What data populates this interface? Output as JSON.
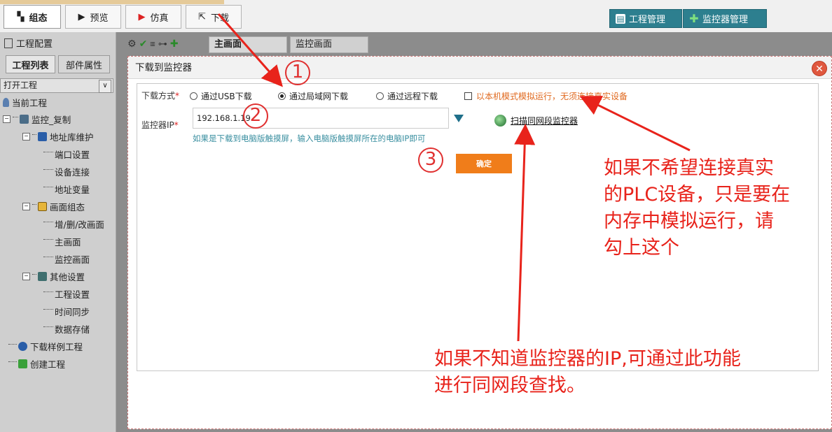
{
  "toolbar": {
    "tabs": [
      {
        "label": "组态",
        "icon": "layout-icon",
        "active": true
      },
      {
        "label": "预览",
        "icon": "play-icon"
      },
      {
        "label": "仿真",
        "icon": "play-red-icon"
      },
      {
        "label": "下载",
        "icon": "share-icon"
      }
    ],
    "project_manager": "工程管理",
    "monitor_manager": "监控器管理",
    "accent": "#2d7f8f"
  },
  "left_panel": {
    "header": "工程配置",
    "tabs": [
      "工程列表",
      "部件属性"
    ],
    "open_project": "打开工程",
    "tree": {
      "current": "当前工程",
      "root": "监控_复制",
      "address_maint": "地址库维护",
      "port_settings": "端口设置",
      "device_connect": "设备连接",
      "address_vars": "地址变量",
      "screen_config": "画面组态",
      "edit_screens": "增/删/改画面",
      "main_screen": "主画面",
      "monitor_screen": "监控画面",
      "other_settings": "其他设置",
      "project_settings": "工程设置",
      "time_sync": "时间同步",
      "data_storage": "数据存储",
      "download_sample": "下载样例工程",
      "create_project": "创建工程"
    }
  },
  "editor": {
    "tabs": [
      "主画面",
      "监控画面"
    ]
  },
  "dialog": {
    "title": "下载到监控器",
    "download_mode_label": "下载方式",
    "required_mark": "*",
    "options": [
      "通过USB下载",
      "通过局域网下载",
      "通过远程下载"
    ],
    "selected_option": 1,
    "simulate_label": "以本机模式模拟运行，无须连接真实设备",
    "ip_label": "监控器IP",
    "ip_value": "192.168.1.19",
    "hint": "如果是下载到电脑版触摸屏，输入电脑版触摸屏所在的电脑IP即可",
    "scan_label": "扫描同网段监控器",
    "ok_label": "确定"
  },
  "annotations": {
    "marker1": "1",
    "marker2": "2",
    "marker3": "3",
    "note_simulate": "如果不希望连接真实\n的PLC设备，只是要在\n内存中模拟运行，请\n勾上这个",
    "note_scan": "如果不知道监控器的IP,可通过此功能\n进行同网段查找。",
    "color": "#e8231b"
  }
}
